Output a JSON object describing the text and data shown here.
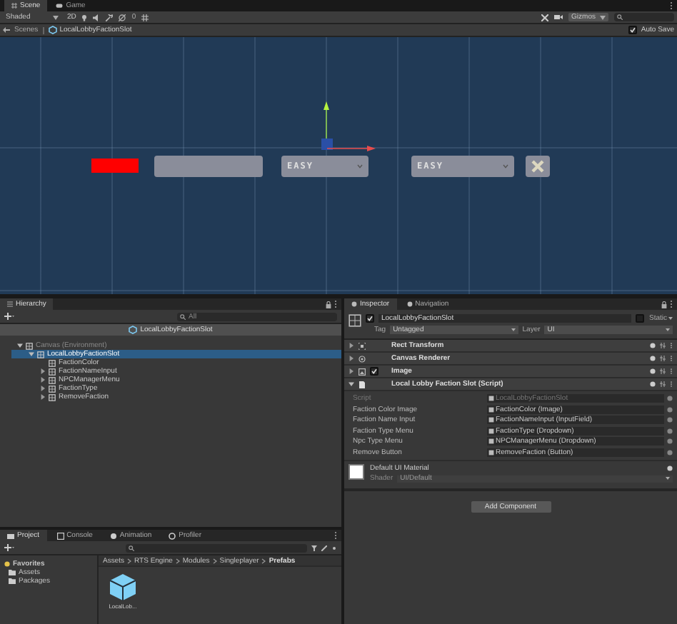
{
  "scene_tabs": [
    {
      "label": "Scene",
      "selected": true
    },
    {
      "label": "Game",
      "selected": false
    }
  ],
  "scene_toolbar": {
    "shading": "Shaded",
    "mode": "2D",
    "layers_count": "0",
    "gizmos": "Gizmos"
  },
  "breadcrumb": {
    "root": "Scenes",
    "prefab": "LocalLobbyFactionSlot",
    "auto_save": {
      "label": "Auto Save",
      "checked": true
    }
  },
  "scene_elements": [
    {
      "kind": "color"
    },
    {
      "kind": "input"
    },
    {
      "kind": "dropdown",
      "value": "EASY"
    },
    {
      "kind": "dropdown",
      "value": "EASY"
    },
    {
      "kind": "remove"
    }
  ],
  "hierarchy": {
    "tab": "Hierarchy",
    "search_placeholder": "All",
    "prefab_header": "LocalLobbyFactionSlot",
    "tree": [
      {
        "label": "Canvas (Environment)",
        "selected": false,
        "expanded": true,
        "children": [
          {
            "label": "LocalLobbyFactionSlot",
            "selected": true,
            "expanded": true,
            "children": [
              {
                "label": "FactionColor",
                "selected": false
              },
              {
                "label": "FactionNameInput",
                "selected": false,
                "expanded": false
              },
              {
                "label": "NPCManagerMenu",
                "selected": false,
                "expanded": false
              },
              {
                "label": "FactionType",
                "selected": false,
                "expanded": false
              },
              {
                "label": "RemoveFaction",
                "selected": false,
                "expanded": false
              }
            ]
          }
        ]
      }
    ]
  },
  "inspector": {
    "tabs": [
      {
        "label": "Inspector",
        "selected": true
      },
      {
        "label": "Navigation",
        "selected": false
      }
    ],
    "object_name": "LocalLobbyFactionSlot",
    "active": true,
    "static": {
      "label": "Static",
      "checked": false
    },
    "tag_label": "Tag",
    "tag": "Untagged",
    "layer_label": "Layer",
    "layer": "UI",
    "components": [
      {
        "name": "Rect Transform",
        "expanded": false
      },
      {
        "name": "Canvas Renderer",
        "expanded": false
      },
      {
        "name": "Image",
        "expanded": false,
        "enabled": true
      },
      {
        "name": "Local Lobby Faction Slot (Script)",
        "expanded": true
      }
    ],
    "fields": [
      {
        "label": "Script",
        "value": "LocalLobbyFactionSlot",
        "disabled": true
      },
      {
        "label": "Faction Color Image",
        "value": "FactionColor (Image)",
        "disabled": false
      },
      {
        "label": "Faction Name Input",
        "value": "FactionNameInput (InputField)",
        "disabled": false
      },
      {
        "label": "Faction Type Menu",
        "value": "FactionType (Dropdown)",
        "disabled": false
      },
      {
        "label": "Npc Type Menu",
        "value": "NPCManagerMenu (Dropdown)",
        "disabled": false
      },
      {
        "label": "Remove Button",
        "value": "RemoveFaction (Button)",
        "disabled": false
      }
    ],
    "material": {
      "name": "Default UI Material",
      "shader_label": "Shader",
      "shader": "UI/Default"
    },
    "add_button": "Add Component"
  },
  "project": {
    "tabs": [
      {
        "label": "Project",
        "selected": true
      },
      {
        "label": "Console",
        "selected": false
      },
      {
        "label": "Animation",
        "selected": false
      },
      {
        "label": "Profiler",
        "selected": false
      }
    ],
    "sidebar": [
      {
        "label": "Favorites",
        "kind": "favorites"
      },
      {
        "label": "Assets",
        "kind": "folder"
      },
      {
        "label": "Packages",
        "kind": "folder"
      }
    ],
    "path": [
      "Assets",
      "RTS Engine",
      "Modules",
      "Singleplayer",
      "Prefabs"
    ],
    "assets": [
      {
        "label": "LocalLob..."
      }
    ]
  }
}
